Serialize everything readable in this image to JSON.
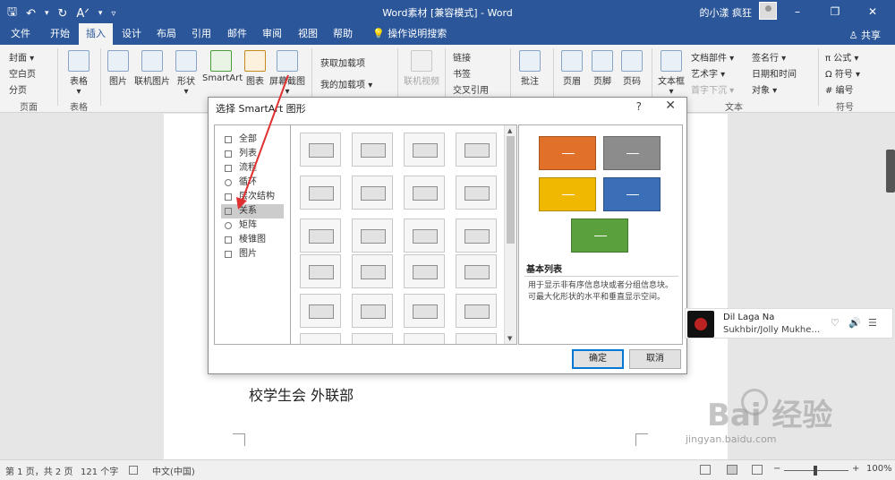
{
  "window": {
    "doc_title": "Word素材 [兼容模式] - Word",
    "user_name": "的小漾 疯狂",
    "controls": {
      "minimize": "–",
      "restore": "❐",
      "close": "✕"
    }
  },
  "qat": {
    "save": "🖫",
    "undo": "↶",
    "undo_drop": "▾",
    "redo": "↻",
    "format": "Aᐟ",
    "format_drop": "▾",
    "customize": "▿"
  },
  "tabs": [
    "文件",
    "开始",
    "插入",
    "设计",
    "布局",
    "引用",
    "邮件",
    "审阅",
    "视图",
    "帮助"
  ],
  "active_tab": "插入",
  "tell_me": {
    "icon": "💡",
    "label": "操作说明搜索"
  },
  "share": "♙ 共享",
  "ribbon": {
    "pages": {
      "cover": "封面 ▾",
      "blank": "空白页",
      "break": "分页",
      "group": "页面"
    },
    "table": {
      "label": "表格",
      "drop": "▾",
      "group": "表格"
    },
    "illustrations": {
      "pictures": "图片",
      "online_pictures": "联机图片",
      "shapes": "形状",
      "shapes_drop": "▾",
      "smartart": "SmartArt",
      "chart": "图表",
      "screenshot": "屏幕截图",
      "screenshot_drop": "▾",
      "group": "插图"
    },
    "addins": {
      "get": "获取加载项",
      "mine": "我的加载项",
      "mine_drop": "▾"
    },
    "media": {
      "online_video": "联机视频"
    },
    "links": {
      "link": "链接",
      "bookmark": "书签",
      "cross_ref": "交叉引用"
    },
    "comments": {
      "comment": "批注"
    },
    "header_footer": {
      "header": "页眉",
      "footer": "页脚",
      "page_number": "页码"
    },
    "text": {
      "textbox": "文本框",
      "textbox_drop": "▾",
      "quick_parts": "文档部件 ▾",
      "wordart": "艺术字 ▾",
      "dropcap": "首字下沉 ▾",
      "signature": "签名行 ▾",
      "datetime": "日期和时间",
      "object": "对象 ▾",
      "group": "文本"
    },
    "symbols": {
      "equation": "π 公式 ▾",
      "symbol": "Ω 符号 ▾",
      "numbering": "# 编号",
      "group": "符号"
    }
  },
  "dialog": {
    "title": "选择 SmartArt 图形",
    "help": "?",
    "close": "✕",
    "categories": [
      "全部",
      "列表",
      "流程",
      "循环",
      "层次结构",
      "关系",
      "矩阵",
      "棱锥图",
      "图片"
    ],
    "selected_category": "关系",
    "preview_title": "基本列表",
    "preview_desc": "用于显示非有序信息块或者分组信息块。可最大化形状的水平和垂直显示空间。",
    "preview_colors": [
      "#e0702a",
      "#8c8c8c",
      "#f0b800",
      "#3a6fb8",
      "#5aa03c"
    ],
    "ok": "确定",
    "cancel": "取消"
  },
  "document": {
    "body_text": "校学生会 外联部"
  },
  "music": {
    "title": "Dil Laga Na",
    "artist": "Sukhbir/Jolly Mukher...",
    "like": "♡",
    "volume": "🔊",
    "more": "☰"
  },
  "statusbar": {
    "page": "第 1 页，共 2 页",
    "words": "121 个字",
    "language": "中文(中国)",
    "zoom_minus": "−",
    "zoom_plus": "+",
    "zoom": "100%",
    "zoom_level": 0.5
  },
  "watermark": {
    "brand": "Bai  经验",
    "url": "jingyan.baidu.com"
  }
}
